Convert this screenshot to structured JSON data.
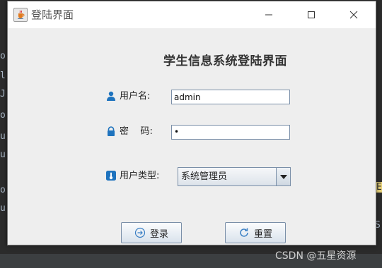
{
  "background": {
    "left_fragments": [
      "or",
      "l",
      "J",
      "or",
      "u",
      "u",
      "or",
      "u"
    ],
    "right_fragments": [
      "E",
      "S"
    ]
  },
  "window": {
    "title": "登陆界面",
    "heading": "学生信息系统登陆界面"
  },
  "form": {
    "username_label": "用户名:",
    "username_value": "admin",
    "password_label": "密    码:",
    "password_value": "•",
    "usertype_label": "用户类型:",
    "usertype_value": "系统管理员"
  },
  "buttons": {
    "login_label": "登录",
    "reset_label": "重置"
  },
  "watermark": "CSDN @五星资源",
  "icons": {
    "app": "java-cup-icon",
    "username": "user-icon",
    "password": "lock-icon",
    "usertype": "thermometer-icon",
    "login": "arrow-right-circle-icon",
    "reset": "refresh-icon"
  },
  "colors": {
    "icon_blue": "#1e73be",
    "window_bg": "#eeeeee"
  }
}
